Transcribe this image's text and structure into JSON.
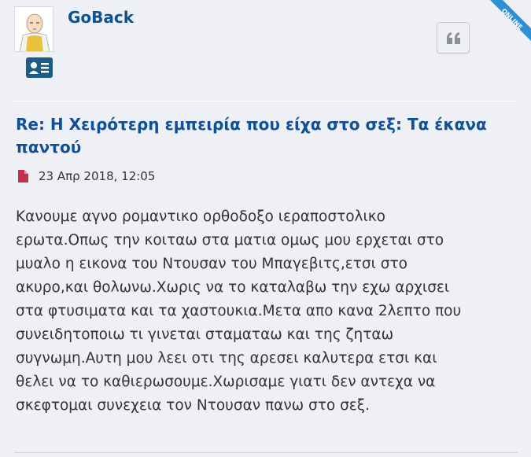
{
  "post": {
    "author": "GoBack",
    "status_ribbon": "ONLINE",
    "title": "Re: Η Χειρότερη εμπειρία που είχα στο σεξ: Τα έκανα παντού",
    "date": "23 Απρ 2018, 12:05",
    "body_lines": [
      "Κανουμε αγνο ρομαντικο ορθοδοξο ιεραποστολικο",
      "ερωτα.Οπως την κοιταω στα ματια ομως μου ερχεται στο",
      "μυαλο η εικονα του Ντουσαν του Μπαγεβιτς,ετσι στο",
      "ακυρο,και θολωνω.Χωρις να το καταλαβω την εχω αρχισει",
      "στα φτυσιματα και τα χαστουκια.Μετα απο κανα 2λεπτο που",
      "συνειδητοποιω τι γινεται σταματαω και της ζηταω",
      "συγνωμη.Αυτη μου λεει οτι της αρεσει καλυτερα ετσι και",
      "θελει να το καθιερωσουμε.Χωρισαμε γιατι δεν αντεχα να",
      "σκεφτομαι συνεχεια τον Ντουσαν πανω στο σεξ."
    ]
  },
  "colors": {
    "author": "#105289",
    "title": "#115098",
    "badge": "#1c5d87",
    "file_icon": "#c0314a",
    "ribbon": "#2f8fd6"
  },
  "icons": {
    "avatar": "bald-hero-avatar",
    "badge": "profile-card-icon",
    "quote": "quote-icon",
    "meta": "file-icon"
  }
}
